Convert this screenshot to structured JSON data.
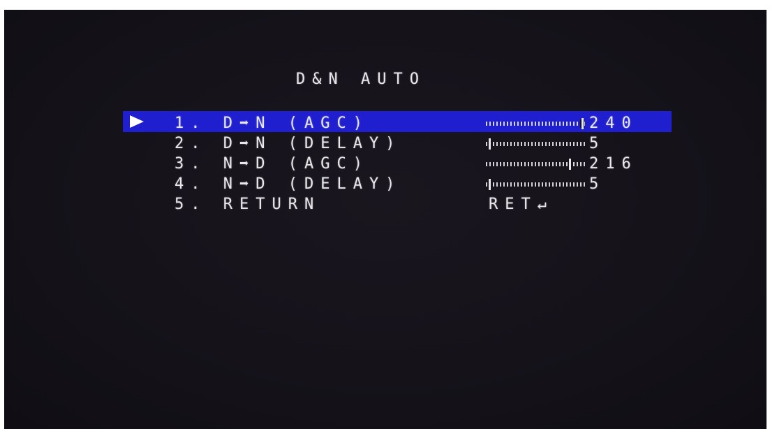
{
  "menu": {
    "title": "D&N AUTO",
    "items": [
      {
        "label": "1. D➡N (AGC)",
        "value": "240",
        "level": 0.96,
        "selected": true
      },
      {
        "label": "2. D➡N (DELAY)",
        "value": "5",
        "level": 0.04,
        "selected": false
      },
      {
        "label": "3. N➡D (AGC)",
        "value": "216",
        "level": 0.84,
        "selected": false
      },
      {
        "label": "4. N➡D (DELAY)",
        "value": "5",
        "level": 0.04,
        "selected": false
      },
      {
        "label": "5. RETURN",
        "value": "",
        "level": null,
        "selected": false
      }
    ],
    "return_value": "RET↵",
    "cursor": "▶"
  },
  "colors": {
    "background": "#15121a",
    "highlight": "#1f1fd0",
    "text": "#e8e8ec"
  }
}
